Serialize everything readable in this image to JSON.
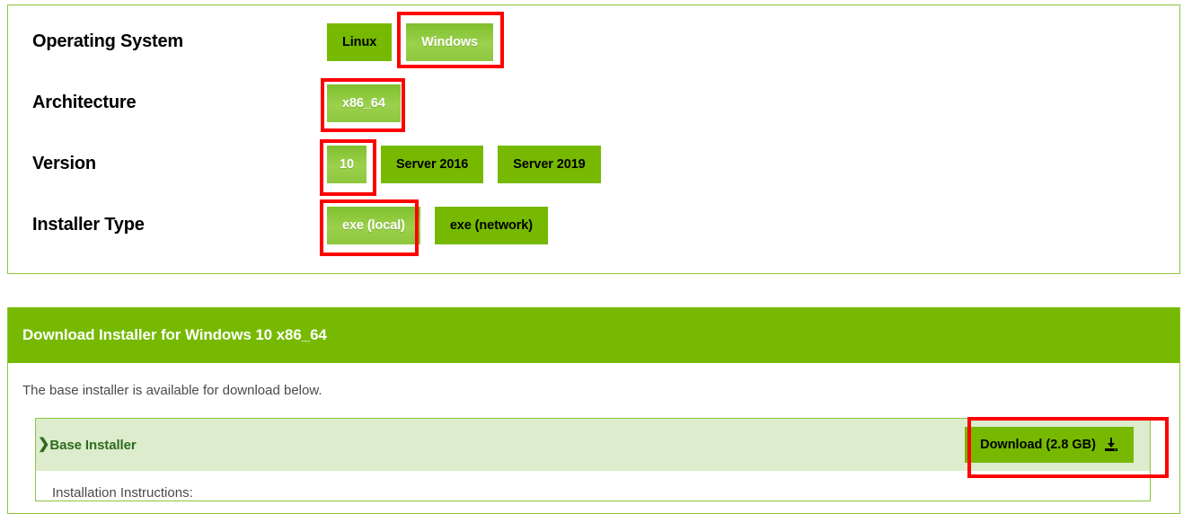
{
  "selector": {
    "rows": [
      {
        "label": "Operating System",
        "options": [
          {
            "label": "Linux",
            "selected": false,
            "annotated": false
          },
          {
            "label": "Windows",
            "selected": true,
            "annotated": true
          }
        ]
      },
      {
        "label": "Architecture",
        "options": [
          {
            "label": "x86_64",
            "selected": true,
            "annotated": true
          }
        ]
      },
      {
        "label": "Version",
        "options": [
          {
            "label": "10",
            "selected": true,
            "annotated": true
          },
          {
            "label": "Server 2016",
            "selected": false,
            "annotated": false
          },
          {
            "label": "Server 2019",
            "selected": false,
            "annotated": false
          }
        ]
      },
      {
        "label": "Installer Type",
        "options": [
          {
            "label": "exe (local)",
            "selected": true,
            "annotated": true
          },
          {
            "label": "exe (network)",
            "selected": false,
            "annotated": false
          }
        ]
      }
    ]
  },
  "download": {
    "header_title": "Download Installer for Windows 10 x86_64",
    "intro_text": "The base installer is available for download below.",
    "installer": {
      "chevron_glyph": "❯",
      "title": "Base Installer",
      "download_label": "Download (2.8 GB)",
      "download_icon": "download-icon",
      "instructions_label": "Installation Instructions:"
    }
  },
  "colors": {
    "nvidia_green": "#76b900",
    "selected_green": "#8ec63f",
    "light_green_row": "#dceccc",
    "panel_border": "#8cc63e",
    "annotation_red": "#ff0000",
    "dark_green_text": "#2f6b1f"
  }
}
